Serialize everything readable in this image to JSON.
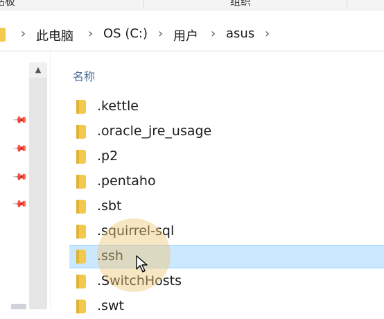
{
  "ribbon": {
    "left_group": "贴板",
    "center_group": "组织"
  },
  "address_bar": {
    "crumbs": [
      "此电脑",
      "OS (C:)",
      "用户",
      "asus"
    ]
  },
  "file_list": {
    "column_header": "名称",
    "items": [
      {
        "name": ".kettle",
        "selected": false
      },
      {
        "name": ".oracle_jre_usage",
        "selected": false
      },
      {
        "name": ".p2",
        "selected": false
      },
      {
        "name": ".pentaho",
        "selected": false
      },
      {
        "name": ".sbt",
        "selected": false
      },
      {
        "name": ".squirrel-sql",
        "selected": false
      },
      {
        "name": ".ssh",
        "selected": true
      },
      {
        "name": ".SwitchHosts",
        "selected": false
      },
      {
        "name": ".swt",
        "selected": false
      }
    ]
  },
  "colors": {
    "selection": "#cce8ff",
    "selection_border": "#99d1ff",
    "folder": "#f2c94c",
    "header_text": "#4a6f9b"
  },
  "icons": {
    "folder": "folder-icon",
    "pin": "pin-icon",
    "scroll_up": "chevron-up-icon",
    "cursor": "mouse-cursor-icon"
  }
}
